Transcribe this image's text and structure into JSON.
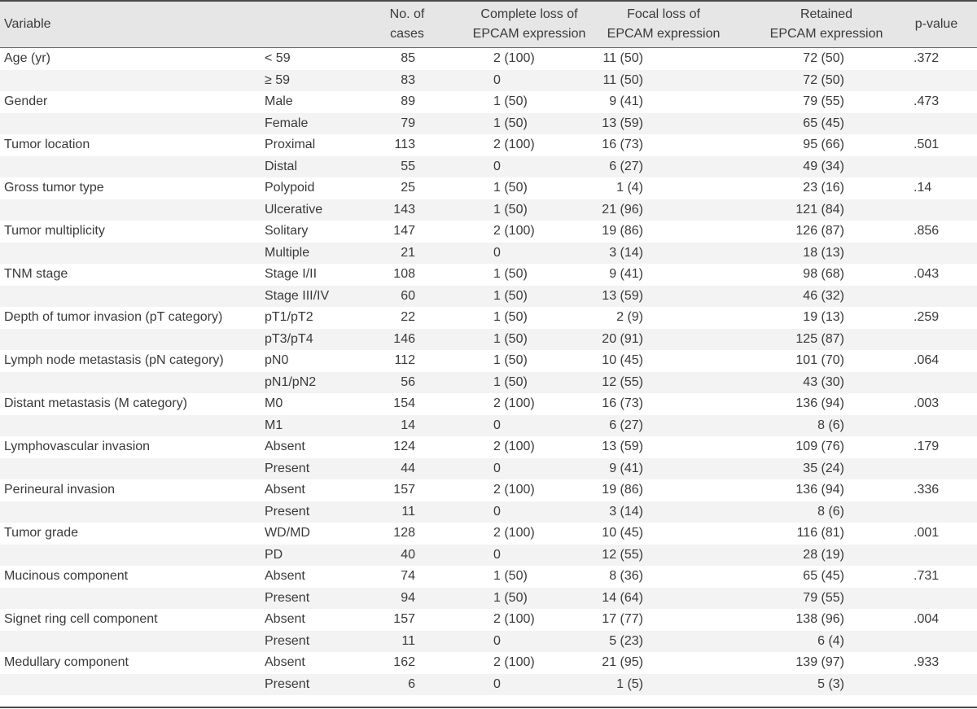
{
  "table": {
    "headers": {
      "variable": "Variable",
      "cases_line1": "No. of",
      "cases_line2": "cases",
      "complete_line1": "Complete loss of",
      "complete_line2": "EPCAM expression",
      "focal_line1": "Focal loss of",
      "focal_line2": "EPCAM expression",
      "retained_line1": "Retained",
      "retained_line2": "EPCAM expression",
      "pvalue": "p-value"
    },
    "rows": [
      {
        "variable": "Age (yr)",
        "sub": "< 59",
        "n": "85",
        "complete": "2 (100)",
        "focal": "11 (50)",
        "retained": "72 (50)",
        "p": ".372"
      },
      {
        "variable": "",
        "sub": "≥ 59",
        "n": "83",
        "complete": "0",
        "focal": "11 (50)",
        "retained": "72 (50)",
        "p": ""
      },
      {
        "variable": "Gender",
        "sub": "Male",
        "n": "89",
        "complete": "1 (50)",
        "focal": "9 (41)",
        "retained": "79 (55)",
        "p": ".473"
      },
      {
        "variable": "",
        "sub": "Female",
        "n": "79",
        "complete": "1 (50)",
        "focal": "13 (59)",
        "retained": "65 (45)",
        "p": ""
      },
      {
        "variable": "Tumor location",
        "sub": "Proximal",
        "n": "113",
        "complete": "2 (100)",
        "focal": "16 (73)",
        "retained": "95 (66)",
        "p": ".501"
      },
      {
        "variable": "",
        "sub": "Distal",
        "n": "55",
        "complete": "0",
        "focal": "6 (27)",
        "retained": "49 (34)",
        "p": ""
      },
      {
        "variable": "Gross tumor type",
        "sub": "Polypoid",
        "n": "25",
        "complete": "1 (50)",
        "focal": "1 (4)",
        "retained": "23 (16)",
        "p": ".14"
      },
      {
        "variable": "",
        "sub": "Ulcerative",
        "n": "143",
        "complete": "1 (50)",
        "focal": "21 (96)",
        "retained": "121 (84)",
        "p": ""
      },
      {
        "variable": "Tumor multiplicity",
        "sub": "Solitary",
        "n": "147",
        "complete": "2 (100)",
        "focal": "19 (86)",
        "retained": "126 (87)",
        "p": ".856"
      },
      {
        "variable": "",
        "sub": "Multiple",
        "n": "21",
        "complete": "0",
        "focal": "3 (14)",
        "retained": "18 (13)",
        "p": ""
      },
      {
        "variable": "TNM stage",
        "sub": "Stage I/II",
        "n": "108",
        "complete": "1 (50)",
        "focal": "9 (41)",
        "retained": "98 (68)",
        "p": ".043"
      },
      {
        "variable": "",
        "sub": "Stage III/IV",
        "n": "60",
        "complete": "1 (50)",
        "focal": "13 (59)",
        "retained": "46 (32)",
        "p": ""
      },
      {
        "variable": "Depth of tumor invasion (pT category)",
        "sub": "pT1/pT2",
        "n": "22",
        "complete": "1 (50)",
        "focal": "2 (9)",
        "retained": "19 (13)",
        "p": ".259"
      },
      {
        "variable": "",
        "sub": "pT3/pT4",
        "n": "146",
        "complete": "1 (50)",
        "focal": "20 (91)",
        "retained": "125 (87)",
        "p": ""
      },
      {
        "variable": "Lymph node metastasis (pN category)",
        "sub": "pN0",
        "n": "112",
        "complete": "1 (50)",
        "focal": "10 (45)",
        "retained": "101 (70)",
        "p": ".064"
      },
      {
        "variable": "",
        "sub": "pN1/pN2",
        "n": "56",
        "complete": "1 (50)",
        "focal": "12 (55)",
        "retained": "43 (30)",
        "p": ""
      },
      {
        "variable": "Distant metastasis (M category)",
        "sub": "M0",
        "n": "154",
        "complete": "2 (100)",
        "focal": "16 (73)",
        "retained": "136 (94)",
        "p": ".003"
      },
      {
        "variable": "",
        "sub": "M1",
        "n": "14",
        "complete": "0",
        "focal": "6 (27)",
        "retained": "8 (6)",
        "p": ""
      },
      {
        "variable": "Lymphovascular invasion",
        "sub": "Absent",
        "n": "124",
        "complete": "2 (100)",
        "focal": "13 (59)",
        "retained": "109 (76)",
        "p": ".179"
      },
      {
        "variable": "",
        "sub": "Present",
        "n": "44",
        "complete": "0",
        "focal": "9 (41)",
        "retained": "35 (24)",
        "p": ""
      },
      {
        "variable": "Perineural invasion",
        "sub": "Absent",
        "n": "157",
        "complete": "2 (100)",
        "focal": "19 (86)",
        "retained": "136 (94)",
        "p": ".336"
      },
      {
        "variable": "",
        "sub": "Present",
        "n": "11",
        "complete": "0",
        "focal": "3 (14)",
        "retained": "8 (6)",
        "p": ""
      },
      {
        "variable": "Tumor grade",
        "sub": "WD/MD",
        "n": "128",
        "complete": "2 (100)",
        "focal": "10 (45)",
        "retained": "116 (81)",
        "p": ".001"
      },
      {
        "variable": "",
        "sub": "PD",
        "n": "40",
        "complete": "0",
        "focal": "12 (55)",
        "retained": "28 (19)",
        "p": ""
      },
      {
        "variable": "Mucinous component",
        "sub": "Absent",
        "n": "74",
        "complete": "1 (50)",
        "focal": "8 (36)",
        "retained": "65 (45)",
        "p": ".731"
      },
      {
        "variable": "",
        "sub": "Present",
        "n": "94",
        "complete": "1 (50)",
        "focal": "14 (64)",
        "retained": "79 (55)",
        "p": ""
      },
      {
        "variable": "Signet ring cell component",
        "sub": "Absent",
        "n": "157",
        "complete": "2 (100)",
        "focal": "17 (77)",
        "retained": "138 (96)",
        "p": ".004"
      },
      {
        "variable": "",
        "sub": "Present",
        "n": "11",
        "complete": "0",
        "focal": "5 (23)",
        "retained": "6 (4)",
        "p": ""
      },
      {
        "variable": "Medullary component",
        "sub": "Absent",
        "n": "162",
        "complete": "2 (100)",
        "focal": "21 (95)",
        "retained": "139 (97)",
        "p": ".933"
      },
      {
        "variable": "",
        "sub": "Present",
        "n": "6",
        "complete": "0",
        "focal": "1 (5)",
        "retained": "5 (3)",
        "p": ""
      }
    ]
  }
}
